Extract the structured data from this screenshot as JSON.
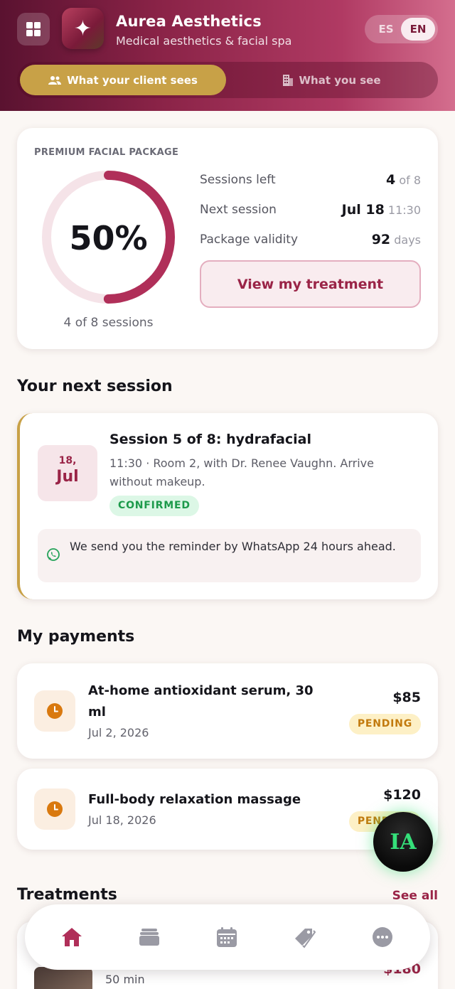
{
  "header": {
    "brand_title": "Aurea Aesthetics",
    "brand_subtitle": "Medical aesthetics & facial spa",
    "lang_es": "ES",
    "lang_en": "EN",
    "view_client": "What your client sees",
    "view_pro": "What you see"
  },
  "package": {
    "label": "PREMIUM FACIAL PACKAGE",
    "percent": "50%",
    "progress_fraction": 0.5,
    "caption": "4 of 8 sessions",
    "sessions_left_label": "Sessions left",
    "sessions_left_value": "4",
    "sessions_left_suffix": "of 8",
    "next_session_label": "Next session",
    "next_session_value": "Jul 18",
    "next_session_time": "11:30",
    "validity_label": "Package validity",
    "validity_value": "92",
    "validity_unit": "days",
    "button": "View my treatment"
  },
  "next_session": {
    "section_title": "Your next session",
    "date_day": "18,",
    "date_month": "Jul",
    "title": "Session 5 of 8: hydrafacial",
    "description": "11:30 · Room 2, with Dr. Renee Vaughn. Arrive without makeup.",
    "status": "CONFIRMED",
    "reminder": "We send you the reminder by WhatsApp 24 hours ahead."
  },
  "payments": {
    "section_title": "My payments",
    "items": [
      {
        "title": "At-home antioxidant serum, 30 ml",
        "date": "Jul 2, 2026",
        "amount": "$85",
        "status": "PENDING"
      },
      {
        "title": "Full-body relaxation massage",
        "date": "Jul 18, 2026",
        "amount": "$120",
        "status": "PENDING"
      }
    ]
  },
  "treatments": {
    "section_title": "Treatments",
    "see_all": "See all",
    "items": [
      {
        "duration": "50 min",
        "price": "$180"
      }
    ]
  },
  "ia_button": "IA",
  "colors": {
    "accent": "#9a2447",
    "gold": "#c8a147",
    "confirmed": "#1d9a4b",
    "pending": "#c27a0e"
  }
}
